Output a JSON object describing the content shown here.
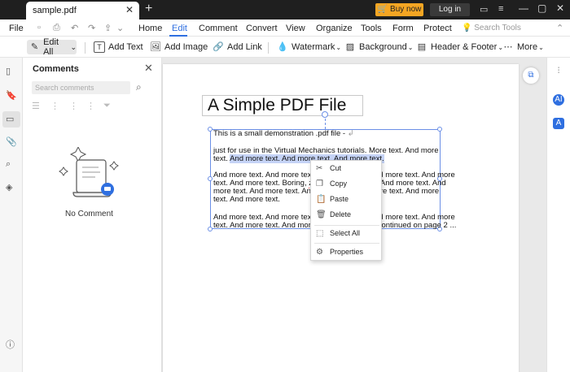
{
  "titlebar": {
    "tab_name": "sample.pdf",
    "tab_close": "✕",
    "new_tab": "+",
    "buy_now": "Buy now",
    "login": "Log in"
  },
  "menu": {
    "file": "File",
    "items": [
      "Home",
      "Edit",
      "Comment",
      "Convert",
      "View",
      "Organize",
      "Tools",
      "Form",
      "Protect"
    ],
    "search_tools": "Search Tools"
  },
  "toolbar": {
    "edit_all": "Edit All",
    "add_text": "Add Text",
    "add_image": "Add Image",
    "add_link": "Add Link",
    "watermark": "Watermark",
    "background": "Background",
    "header_footer": "Header & Footer",
    "more": "More"
  },
  "comments_panel": {
    "title": "Comments",
    "search_placeholder": "Search comments",
    "empty_text": "No Comment"
  },
  "document": {
    "title": "A Simple PDF File",
    "line1": "This is a small demonstration .pdf file -",
    "line2": "just for use in the Virtual Mechanics tutorials. More text. And more",
    "line3_a": "text. ",
    "line3_b": "And more text. And more text. And more text.",
    "line4": "And more text. And more text. And more text. And more text. And more",
    "line5_a": "text. And more text. Boring, ",
    "line5_b": "zzzz",
    "line5_c": ". And more text. And more text. And",
    "line6": "more text. And more text. And more text. And more text. And more",
    "line7": "text. And more text.",
    "line8": "And more text. And more text. And more text. And more text. And more",
    "line9": "text. And more text. And more text. Even more. Continued on page 2 ..."
  },
  "context_menu": {
    "cut": "Cut",
    "copy": "Copy",
    "paste": "Paste",
    "delete": "Delete",
    "select_all": "Select All",
    "properties": "Properties"
  },
  "colors": {
    "accent": "#2f6fe0",
    "buy_button": "#f5a623",
    "titlebar": "#1f1f1f",
    "selection": "#c5d3f6"
  }
}
